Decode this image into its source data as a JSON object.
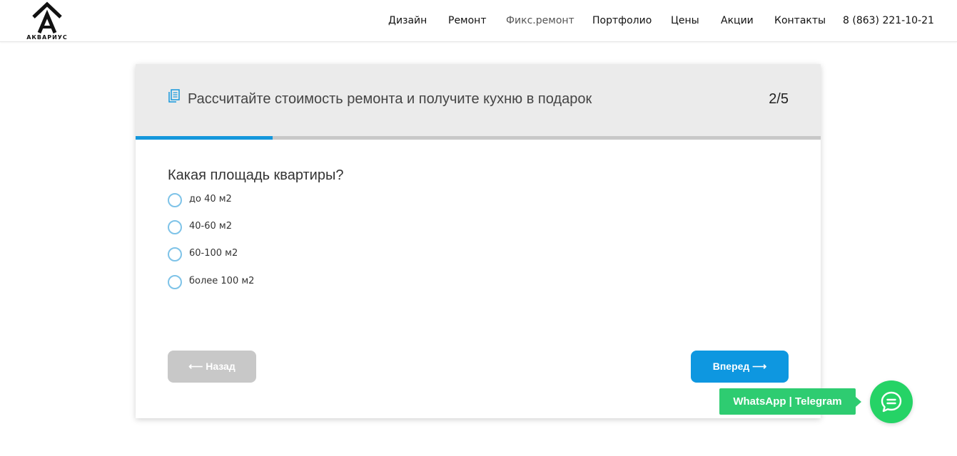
{
  "header": {
    "logo_text": "АКВАРИУС",
    "nav": [
      {
        "label": "Дизайн"
      },
      {
        "label": "Ремонт"
      },
      {
        "label": "Фикс.ремонт"
      },
      {
        "label": "Портфолио"
      },
      {
        "label": "Цены"
      },
      {
        "label": "Акции"
      },
      {
        "label": "Контакты"
      }
    ],
    "phone": "8 (863) 221-10-21"
  },
  "quiz": {
    "title": "Рассчитайте стоимость ремонта и получите кухню в подарок",
    "step": "2/5",
    "progress_fraction": 0.2,
    "question": "Какая площадь квартиры?",
    "options": [
      {
        "label": "до 40 м2",
        "selected": false
      },
      {
        "label": "40-60 м2",
        "selected": false
      },
      {
        "label": "60-100 м2",
        "selected": false
      },
      {
        "label": "более 100 м2",
        "selected": false
      }
    ],
    "back_label": "⟵ Назад",
    "next_label": "Вперед ⟶"
  },
  "chat": {
    "label": "WhatsApp | Telegram"
  },
  "colors": {
    "accent": "#0e97e0",
    "chat_green": "#25d366",
    "progress_track": "#c8c8c8",
    "header_bg": "#ebebeb"
  }
}
